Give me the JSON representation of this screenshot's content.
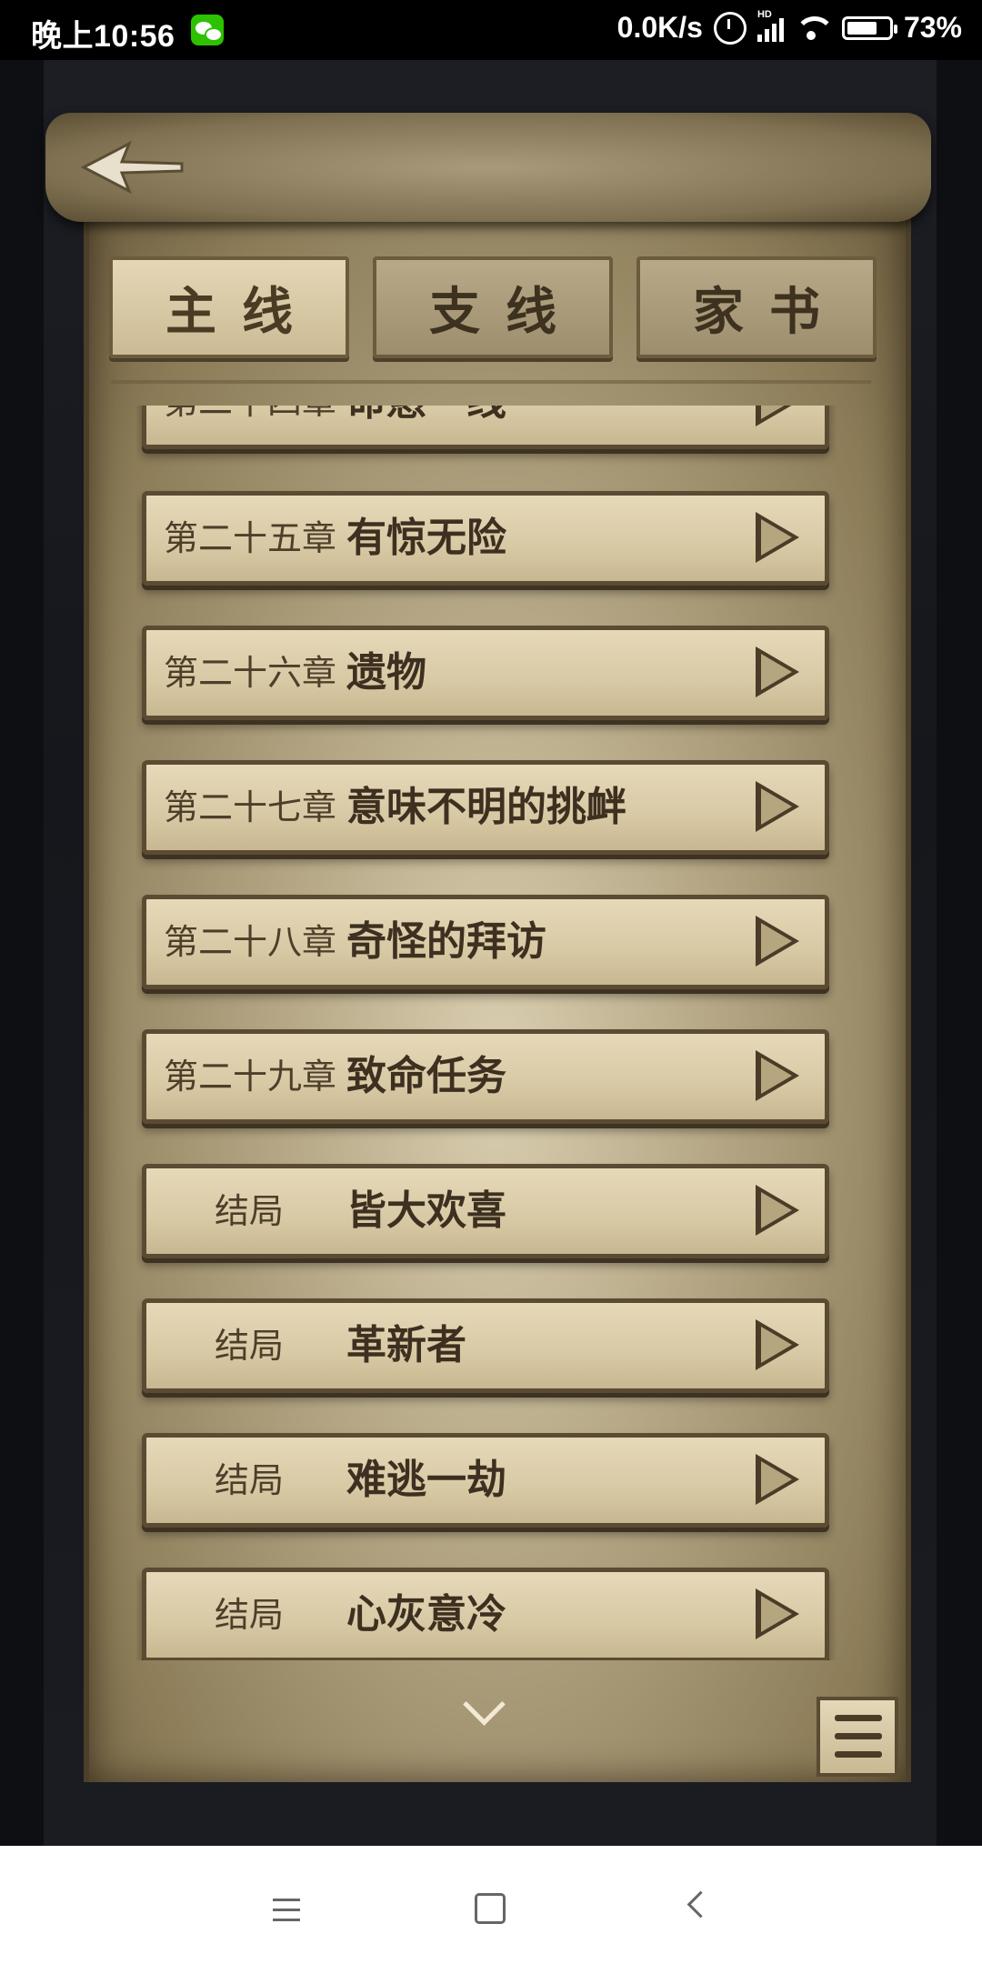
{
  "status_bar": {
    "time": "晚上10:56",
    "network_speed": "0.0K/s",
    "battery_percent": "73%",
    "battery_level": 0.73,
    "signal_label": "HD"
  },
  "tabs": [
    {
      "label": "主线",
      "active": true
    },
    {
      "label": "支线",
      "active": false
    },
    {
      "label": "家书",
      "active": false
    }
  ],
  "chapters": [
    {
      "number": "第二十四章",
      "title": "命悬一线"
    },
    {
      "number": "第二十五章",
      "title": "有惊无险"
    },
    {
      "number": "第二十六章",
      "title": "遗物"
    },
    {
      "number": "第二十七章",
      "title": "意味不明的挑衅"
    },
    {
      "number": "第二十八章",
      "title": "奇怪的拜访"
    },
    {
      "number": "第二十九章",
      "title": "致命任务"
    },
    {
      "number": "结局",
      "title": "皆大欢喜"
    },
    {
      "number": "结局",
      "title": "革新者"
    },
    {
      "number": "结局",
      "title": "难逃一劫"
    },
    {
      "number": "结局",
      "title": "心灰意冷"
    }
  ],
  "icons": {
    "back": "arrow-back-icon",
    "play": "play-icon",
    "scroll_down": "chevron-down-icon",
    "menu": "list-menu-icon"
  },
  "colors": {
    "parchment": "#d9ceb0",
    "ink": "#3d3020",
    "frame": "#5b4b33"
  }
}
